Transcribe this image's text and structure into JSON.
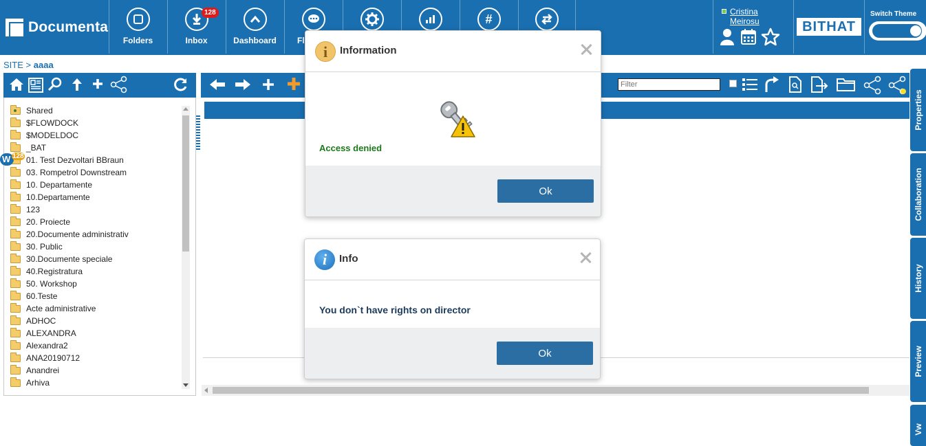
{
  "app": {
    "name": "Documenta"
  },
  "nav": {
    "items": [
      {
        "label": "Folders",
        "icon": "folders-icon"
      },
      {
        "label": "Inbox",
        "icon": "inbox-icon",
        "badge": "128"
      },
      {
        "label": "Dashboard",
        "icon": "dashboard-icon"
      },
      {
        "label": "Fl",
        "icon": "flow-icon"
      },
      {
        "label": "",
        "icon": "settings-icon"
      },
      {
        "label": "",
        "icon": "reports-icon"
      },
      {
        "label": "",
        "icon": "hashtag-icon"
      },
      {
        "label": "",
        "icon": "transfer-icon"
      }
    ]
  },
  "user": {
    "first": "Cristina",
    "last": "Meirosu"
  },
  "brand": {
    "partner": "BITHAT"
  },
  "theme": {
    "switch_label": "Switch Theme",
    "on": true
  },
  "breadcrumb": {
    "root": "SITE",
    "separator": ">",
    "current": "aaaa"
  },
  "tree": {
    "items": [
      {
        "label": "Shared",
        "shared": true
      },
      {
        "label": "$FLOWDOCK"
      },
      {
        "label": "$MODELDOC"
      },
      {
        "label": "_BAT"
      },
      {
        "label": "01. Test Dezvoltari BBraun"
      },
      {
        "label": "03. Rompetrol Downstream"
      },
      {
        "label": "10. Departamente"
      },
      {
        "label": "10.Departamente"
      },
      {
        "label": "123"
      },
      {
        "label": "20. Proiecte"
      },
      {
        "label": "20.Documente administrativ"
      },
      {
        "label": "30. Public"
      },
      {
        "label": "30.Documente speciale"
      },
      {
        "label": "40.Registratura"
      },
      {
        "label": "50. Workshop"
      },
      {
        "label": "60.Teste"
      },
      {
        "label": "Acte administrative"
      },
      {
        "label": "ADHOC"
      },
      {
        "label": "ALEXANDRA"
      },
      {
        "label": "Alexandra2"
      },
      {
        "label": "ANA20190712"
      },
      {
        "label": "Anandrei"
      },
      {
        "label": "Arhiva"
      }
    ]
  },
  "w_badge": {
    "letter": "W",
    "count": "128"
  },
  "toolbar": {
    "filter_placeholder": "Filter"
  },
  "side_tabs": [
    "Properties",
    "Collaboration",
    "History",
    "Preview",
    "Vw"
  ],
  "dialogs": {
    "information": {
      "title": "Information",
      "message": "Access denied",
      "ok_label": "Ok"
    },
    "info": {
      "title": "Info",
      "message": "You don`t have rights on director",
      "ok_label": "Ok"
    }
  },
  "colors": {
    "primary": "#1a6fb0",
    "button": "#2b6ea3",
    "success_text": "#1a7a1a",
    "badge": "#e01919"
  }
}
